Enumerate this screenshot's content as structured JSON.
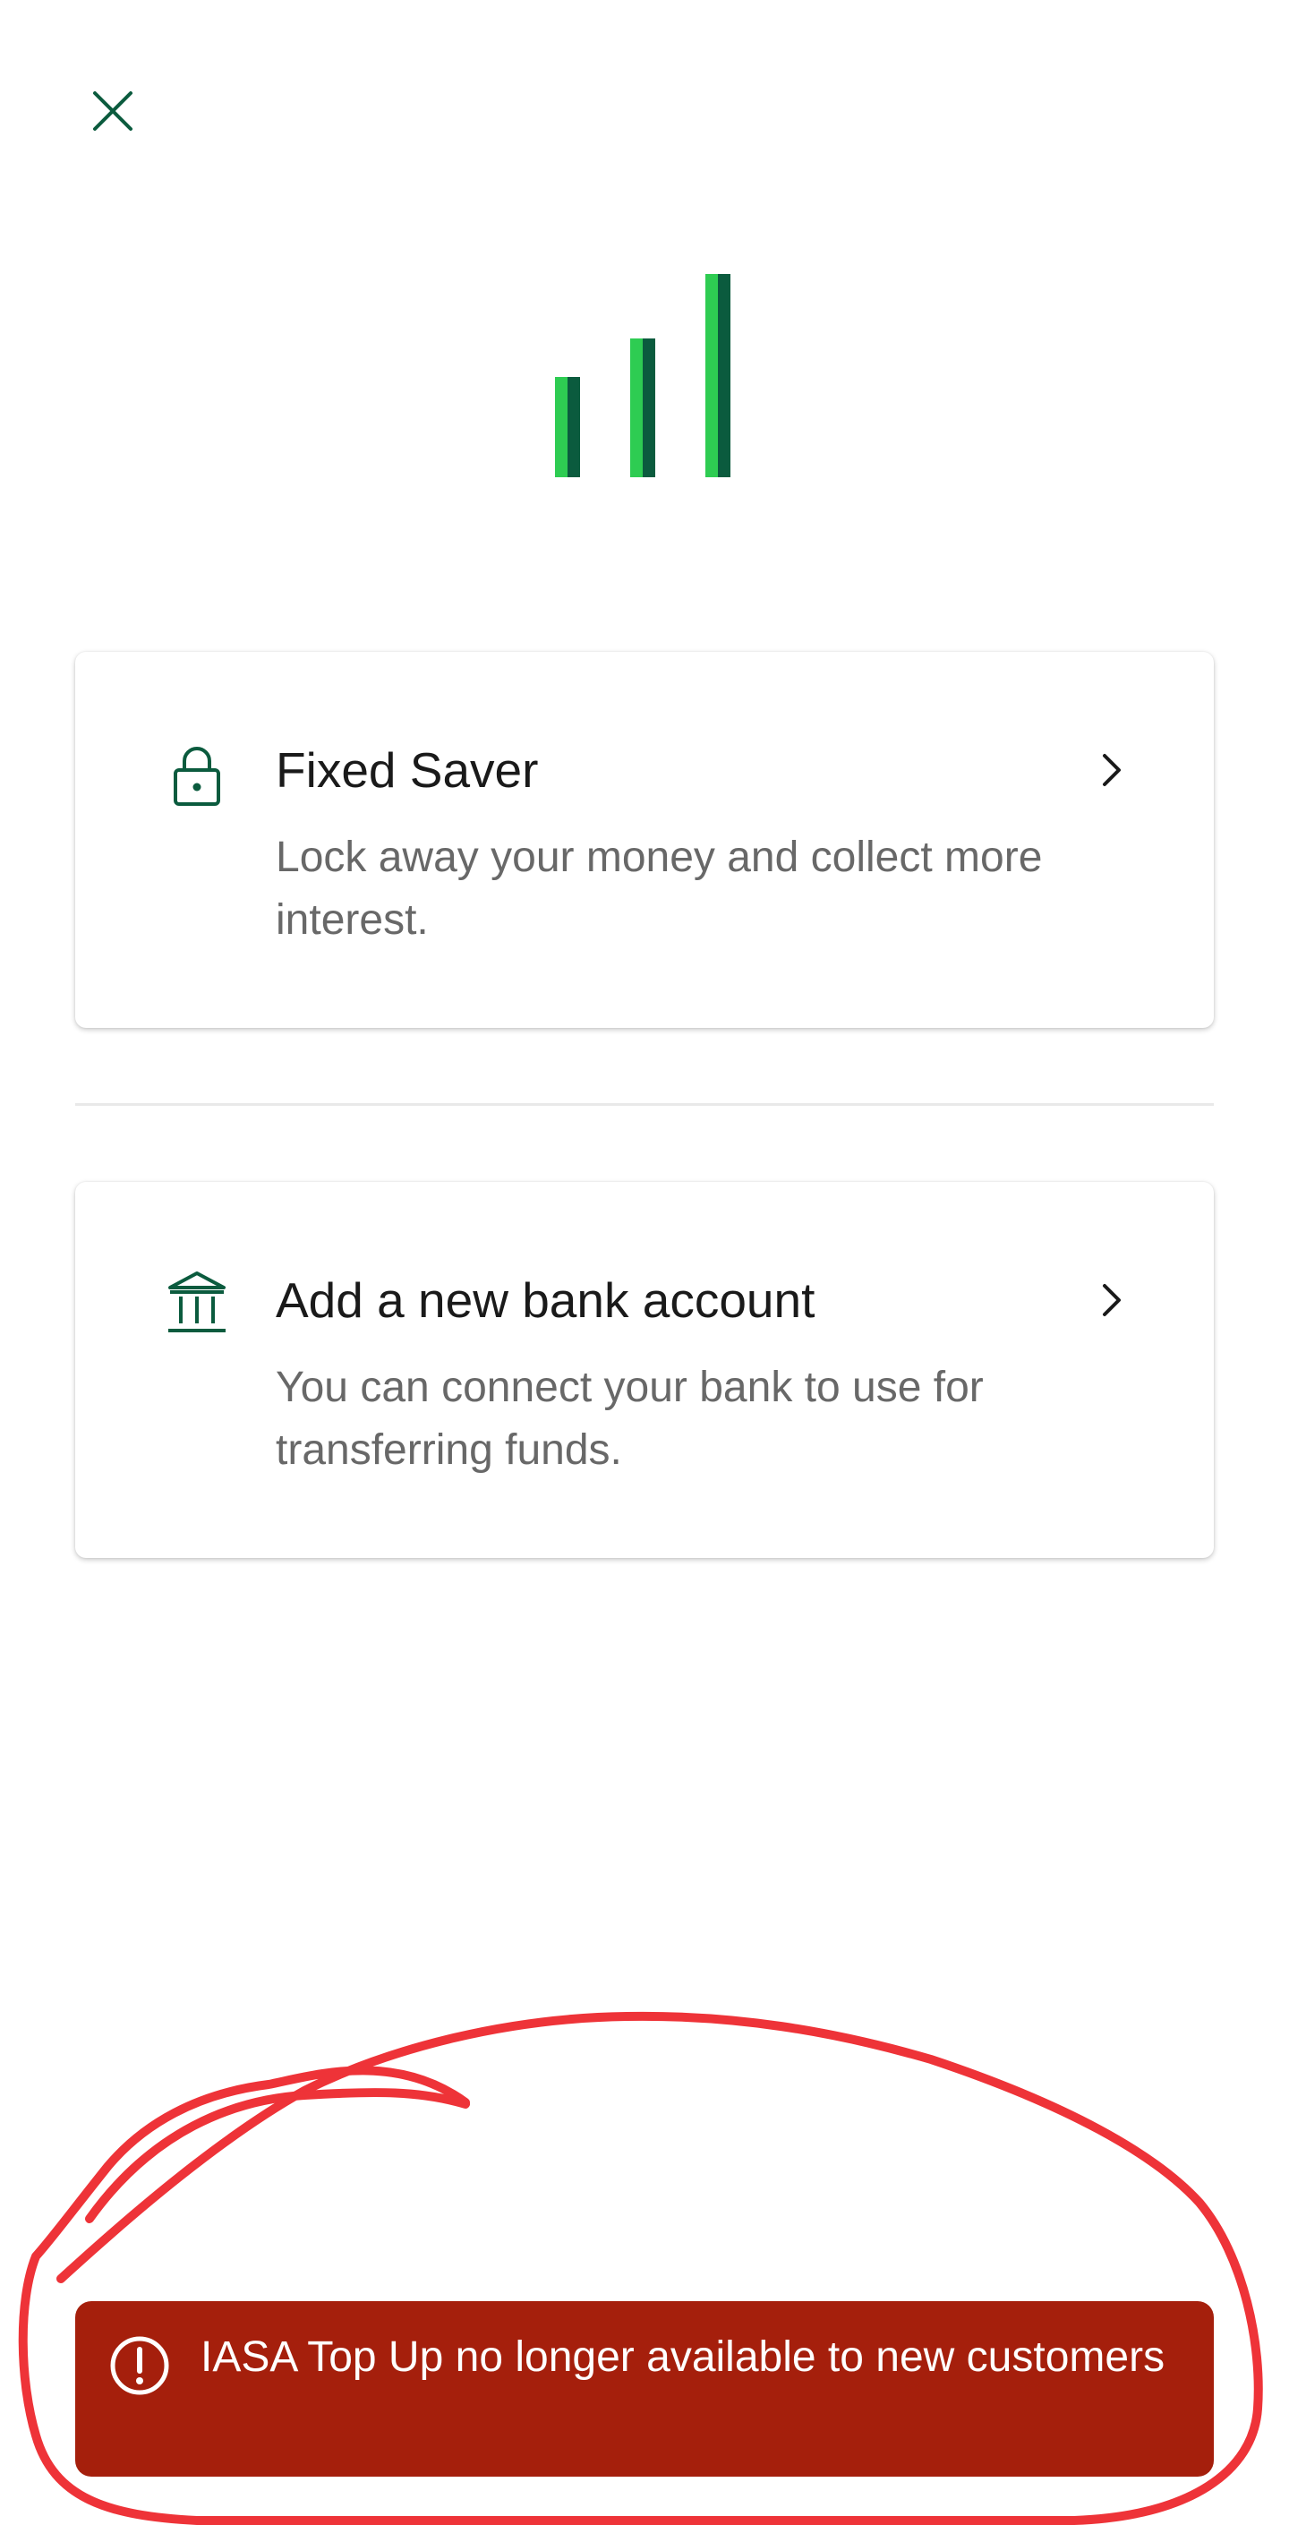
{
  "header": {
    "close_icon": "close-icon"
  },
  "logo": {
    "icon": "signal-bars-logo",
    "colors": {
      "light": "#2ecc52",
      "dark": "#0b5b3e"
    }
  },
  "options": [
    {
      "icon": "lock-icon",
      "title": "Fixed Saver",
      "description": "Lock away your money and collect more interest.",
      "chevron": "chevron-right-icon"
    },
    {
      "icon": "bank-icon",
      "title": "Add a new bank account",
      "description": "You can connect your bank to use for transferring funds.",
      "chevron": "chevron-right-icon"
    }
  ],
  "snackbar": {
    "icon": "alert-circle-icon",
    "message": "IASA Top Up no longer available to new customers",
    "background": "#a51f0c"
  },
  "colors": {
    "accent": "#0b5b3e",
    "annotation": "#ee3338"
  }
}
